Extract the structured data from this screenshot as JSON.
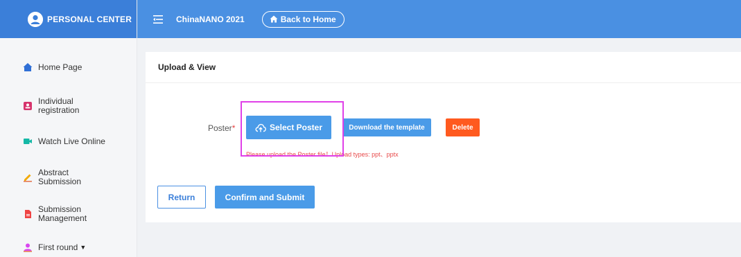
{
  "sidebar": {
    "brand": "PERSONAL CENTER",
    "items": [
      {
        "label": "Home Page",
        "icon": "home-icon"
      },
      {
        "label": "Individual\nregistration",
        "icon": "id-card-icon"
      },
      {
        "label": "Watch Live Online",
        "icon": "video-camera-icon"
      },
      {
        "label": "Abstract\nSubmission",
        "icon": "pen-icon"
      },
      {
        "label": "Submission\nManagement",
        "icon": "document-icon"
      },
      {
        "label": "First round",
        "icon": "user-icon",
        "caret": "▼"
      }
    ]
  },
  "topbar": {
    "title": "ChinaNANO 2021",
    "back_label": "Back to Home"
  },
  "card": {
    "title": "Upload & View",
    "poster_label": "Poster",
    "required_mark": "*",
    "select_label": "Select Poster",
    "template_label": "Download the template",
    "delete_label": "Delete",
    "hint": "Please upload the Poster file！Upload types: ppt、pptx",
    "return_label": "Return",
    "confirm_label": "Confirm and Submit"
  },
  "colors": {
    "brand_blue": "#3b7fd9",
    "topbar_blue": "#4a90e2",
    "button_blue": "#4a9be8",
    "delete_orange": "#ff5a1f",
    "highlight_magenta": "#e040e8",
    "hint_red": "#e8494a"
  }
}
